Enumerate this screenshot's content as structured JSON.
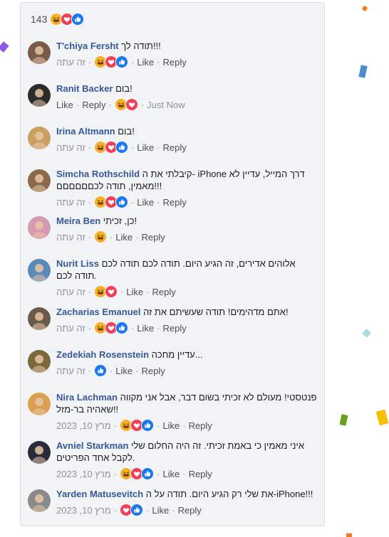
{
  "summary": {
    "count": "143",
    "reactions": [
      "haha",
      "love",
      "like"
    ]
  },
  "comments": [
    {
      "name": "T'chiya Fersht",
      "text": "תודה לך!!!",
      "time": "זה עתה",
      "reactions": [
        "haha",
        "love",
        "like"
      ],
      "like": "Like",
      "reply": "Reply",
      "order": "time-first",
      "avatar_color": "#7a5a48"
    },
    {
      "name": "Ranit Backer",
      "text": "בום!",
      "time": "Just Now",
      "reactions": [
        "haha",
        "love"
      ],
      "like": "Like",
      "reply": "Reply",
      "order": "actions-first",
      "avatar_color": "#2b2b2b"
    },
    {
      "name": "Irina Altmann",
      "text": "בום!",
      "time": "זה עתה",
      "reactions": [
        "haha",
        "love",
        "like"
      ],
      "like": "Like",
      "reply": "Reply",
      "order": "time-first",
      "avatar_color": "#c8a060"
    },
    {
      "name": "Simcha Rothschild",
      "text": "קיבלתי את ה- iPhone דרך המייל, עדיין לא מאמין, תודה לכםםםםםם!!!",
      "time": "זה עתה",
      "reactions": [
        "haha",
        "love",
        "like"
      ],
      "like": "Like",
      "reply": "Reply",
      "order": "time-first",
      "avatar_color": "#8a6a4a"
    },
    {
      "name": "Meira Ben",
      "text": "כן, זכיתי!",
      "time": "זה עתה",
      "reactions": [
        "haha"
      ],
      "like": "Like",
      "reply": "Reply",
      "order": "time-first",
      "avatar_color": "#d59ab0"
    },
    {
      "name": "Nurit Liss",
      "text": "אלוהים אדירים, זה הגיע היום. תודה לכם תודה לכם תודה לכם.",
      "time": "זה עתה",
      "reactions": [
        "haha",
        "love"
      ],
      "like": "Like",
      "reply": "Reply",
      "order": "time-first",
      "avatar_color": "#5a8ab8"
    },
    {
      "name": "Zacharias Emanuel",
      "text": "אתם מדהימים! תודה שעשיתם את זה!",
      "time": "זה עתה",
      "reactions": [
        "haha",
        "love",
        "like"
      ],
      "like": "Like",
      "reply": "Reply",
      "order": "time-first",
      "avatar_color": "#6a5a4a"
    },
    {
      "name": "Zedekiah Rosenstein",
      "text": "עדיין מחכה...",
      "time": "זה עתה",
      "reactions": [
        "like"
      ],
      "like": "Like",
      "reply": "Reply",
      "order": "time-first",
      "avatar_color": "#7a6a3a"
    },
    {
      "name": "Nira Lachman",
      "text": "פנטסטי! מעולם לא זכיתי בשום דבר, אבל אני מקווה שאהיה בר-מזל!!",
      "time": "מרץ 10, 2023",
      "reactions": [
        "haha",
        "love",
        "like"
      ],
      "like": "Like",
      "reply": "Reply",
      "order": "time-first",
      "avatar_color": "#d8a050"
    },
    {
      "name": "Avniel Starkman",
      "text": "איני מאמין כי באמת זכיתי. זה היה החלום שלי לקבל אחד הפריטים.",
      "time": "מרץ 10, 2023",
      "reactions": [
        "haha",
        "love",
        "like"
      ],
      "like": "Like",
      "reply": "Reply",
      "order": "time-first",
      "avatar_color": "#2a2a3a"
    },
    {
      "name": "Yarden Matusevitch",
      "text": "את שלי רק הגיע היום. תודה על ה-iPhone!!!",
      "time": "מרץ 10, 2023",
      "reactions": [
        "love",
        "like"
      ],
      "like": "Like",
      "reply": "Reply",
      "order": "time-first",
      "avatar_color": "#8a8a8a"
    }
  ],
  "colors": {
    "name": "#385898",
    "link": "#4b4f56",
    "muted": "#90949c",
    "like": "#1877f2",
    "love": "#f33e58",
    "haha": "#f7b125"
  }
}
